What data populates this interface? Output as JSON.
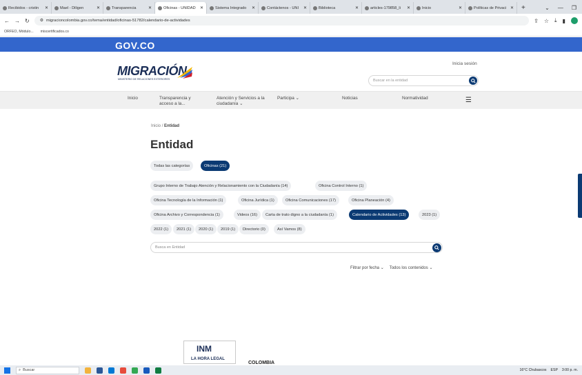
{
  "browser": {
    "tabs": [
      {
        "label": "Recibidos - cristin"
      },
      {
        "label": "Mael - Diligen"
      },
      {
        "label": "Transparencia"
      },
      {
        "label": "Oficinas - UNIDAD",
        "active": true
      },
      {
        "label": "Sistema Integrado"
      },
      {
        "label": "Contáctenos - UNI"
      },
      {
        "label": "Biblioteca"
      },
      {
        "label": "articles-179858_li"
      },
      {
        "label": "Inicio"
      },
      {
        "label": "Políticas de Privaci"
      }
    ],
    "new_tab": "+",
    "url": "migracioncolombia.gov.co/tema/entidad/oficinas-51782/calendario-de-actividades",
    "bookmarks": [
      "ORFEO, Módulo...",
      "miscertificados.co"
    ]
  },
  "gov": {
    "logo_text": "GOV.CO"
  },
  "header": {
    "logo_word": "MIGRACIÓN",
    "logo_tag": "MINISTERIO DE RELACIONES EXTERIORES",
    "login": "Inicia sesión",
    "search_placeholder": "Buscar en la entidad"
  },
  "nav": {
    "items": [
      {
        "label": "Inicio"
      },
      {
        "label": "Transparencia y acceso a la..."
      },
      {
        "label": "Atención y Servicios a la ciudadanía"
      },
      {
        "label": "Participa"
      },
      {
        "label": "Noticias"
      },
      {
        "label": "Normatividad"
      }
    ]
  },
  "page": {
    "breadcrumb_home": "Inicio",
    "breadcrumb_sep": "/",
    "breadcrumb_current": "Entidad",
    "title": "Entidad",
    "categories": [
      {
        "label": "Todas las categorías",
        "selected": false
      },
      {
        "label": "Oficinas (21)",
        "selected": true
      }
    ],
    "subcategories": [
      {
        "label": "Grupo Interno de Trabajo Atención y Relacionamiento con la Ciudadanía (14)",
        "selected": false
      },
      {
        "label": "Oficina Control Interno (1)",
        "selected": false
      },
      {
        "label": "Oficina Tecnología de la Información (1)",
        "selected": false
      },
      {
        "label": "Oficina Jurídica (1)",
        "selected": false
      },
      {
        "label": "Oficina Comunicaciones (17)",
        "selected": false
      },
      {
        "label": "Oficina Planeación (4)",
        "selected": false
      },
      {
        "label": "Oficina Archivo y Correspondencia (1)",
        "selected": false
      },
      {
        "label": "Videos (16)",
        "selected": false
      },
      {
        "label": "Carta de trato digno a la ciudadanía (1)",
        "selected": false
      },
      {
        "label": "Calendario de Actividades (13)",
        "selected": true
      },
      {
        "label": "2023 (1)",
        "selected": false
      },
      {
        "label": "2022 (1)",
        "selected": false
      },
      {
        "label": "2021 (1)",
        "selected": false
      },
      {
        "label": "2020 (1)",
        "selected": false
      },
      {
        "label": "2019 (1)",
        "selected": false
      },
      {
        "label": "Directorio (0)",
        "selected": false
      },
      {
        "label": "Así Vamos (8)",
        "selected": false
      }
    ],
    "search_placeholder": "Busca en Entidad",
    "filter_date": "Filtrar por fecha",
    "filter_content": "Todos los contenidos"
  },
  "footer": {
    "inm_logo": "INM",
    "inm_caption": "LA HORA LEGAL",
    "colombia": "COLOMBIA"
  },
  "taskbar": {
    "search": "Buscar",
    "weather": "16°C Chubascos",
    "lang": "ESP",
    "time": "3:00 p. m."
  },
  "colors": {
    "gov_blue": "#3366cc",
    "primary": "#0b3a73"
  }
}
